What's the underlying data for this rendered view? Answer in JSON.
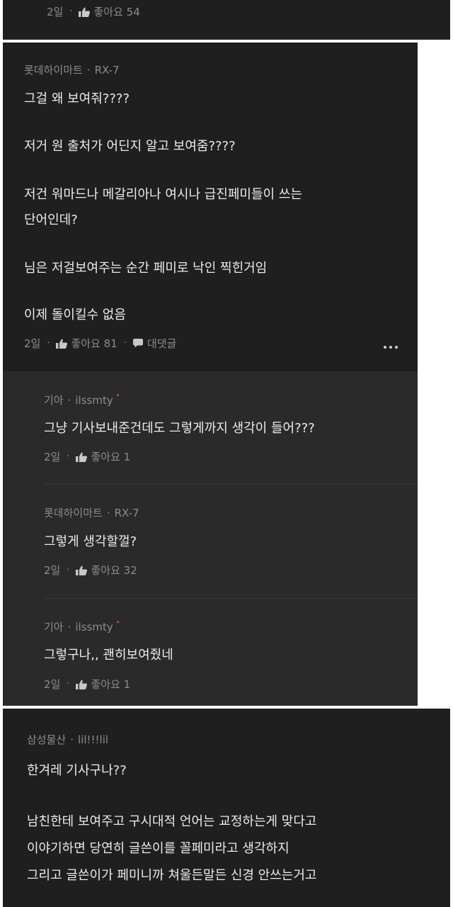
{
  "icons": {
    "like": "thumbs-up-icon",
    "reply": "speech-bubble-icon",
    "more": "more-dots-icon"
  },
  "colors": {
    "background": "#1f1f1f",
    "reply_background": "#2a2a2a",
    "meta_text": "#8c8c8c",
    "new_dot": "#e74c3c"
  },
  "top_comment": {
    "age": "2일",
    "likes_label": "좋아요 54"
  },
  "comment_main": {
    "author_store": "롯데하이마트",
    "author_id": "RX-7",
    "lines": [
      "그걸 왜 보여줘????",
      "저거  원 출처가  어딘지  알고 보여줌????",
      "저건 워마드나  메갈리아나 여시나  급진페미들이 쓰는",
      "단어인데?",
      "님은 저걸보여주는 순간  페미로 낙인 찍힌거임",
      "이제 돌이킬수 없음"
    ],
    "age": "2일",
    "likes_label": "좋아요 81",
    "reply_label": "대댓글"
  },
  "replies": [
    {
      "author_store": "기아",
      "author_id": "ilssmty",
      "new": "•",
      "text": "그냥 기사보내준건데도 그렇게까지 생각이 들어???",
      "age": "2일",
      "likes_label": "좋아요 1"
    },
    {
      "author_store": "롯데하이마트",
      "author_id": "RX-7",
      "text": "그렇게 생각할껄?",
      "age": "2일",
      "likes_label": "좋아요 32"
    },
    {
      "author_store": "기아",
      "author_id": "ilssmty",
      "new": "•",
      "text": "그렇구나,, 괜히보여줬네",
      "age": "2일",
      "likes_label": "좋아요 1"
    }
  ],
  "comment_bottom": {
    "author_store": "삼성물산",
    "author_id": "lil!!!lil",
    "lines": [
      "한겨레 기사구나??",
      "남친한테 보여주고 구시대적 언어는 교정하는게 맞다고",
      "이야기하면 당연히 글쓴이를 꼴페미라고 생각하지",
      "그리고 글쓴이가 페미니까 쳐울든말든 신경 안쓰는거고"
    ]
  }
}
